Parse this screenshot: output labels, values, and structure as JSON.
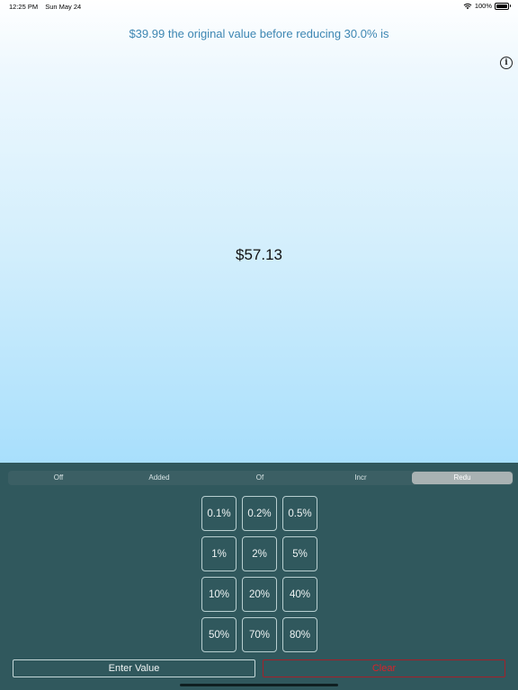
{
  "status_bar": {
    "time": "12:25 PM",
    "date": "Sun May 24",
    "battery": "100%",
    "wifi_icon": "wifi-icon",
    "battery_icon": "battery-icon"
  },
  "calculation": {
    "question": "$39.99 the original value before reducing 30.0% is",
    "result": "$57.13"
  },
  "info": {
    "glyph": "i",
    "icon": "info-icon"
  },
  "modes": {
    "items": [
      {
        "label": "Off"
      },
      {
        "label": "Added"
      },
      {
        "label": "Of"
      },
      {
        "label": "Incr"
      },
      {
        "label": "Redu"
      }
    ],
    "selected": "Redu"
  },
  "percent_buttons": [
    {
      "label": "0.1%"
    },
    {
      "label": "0.2%"
    },
    {
      "label": "0.5%"
    },
    {
      "label": "1%"
    },
    {
      "label": "2%"
    },
    {
      "label": "5%"
    },
    {
      "label": "10%"
    },
    {
      "label": "20%"
    },
    {
      "label": "40%"
    },
    {
      "label": "50%"
    },
    {
      "label": "70%"
    },
    {
      "label": "80%"
    }
  ],
  "actions": {
    "enter_value": "Enter Value",
    "clear": "Clear"
  },
  "colors": {
    "question_text": "#3d86b2",
    "panel_background": "#30585d",
    "clear_text": "#d8222a"
  }
}
